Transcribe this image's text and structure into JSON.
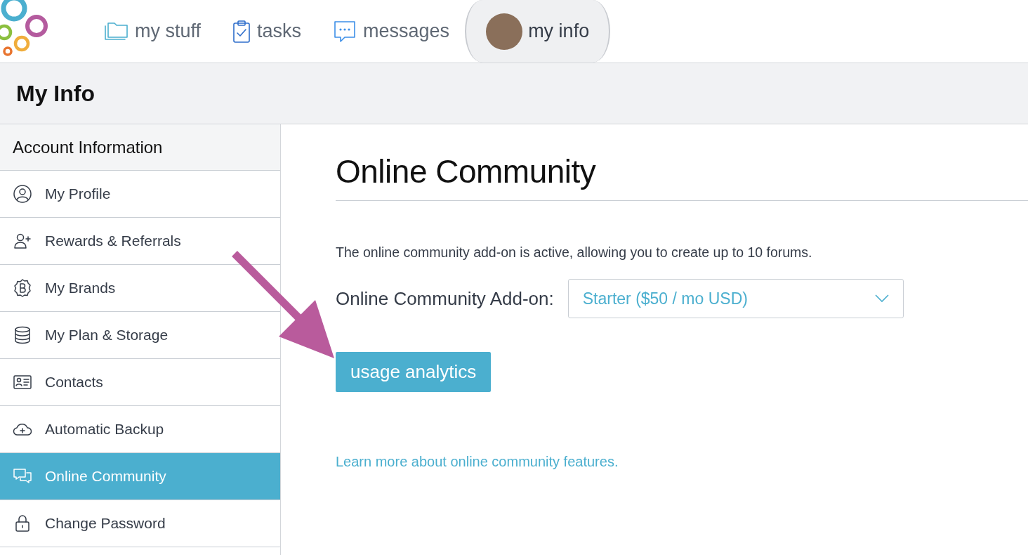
{
  "nav": {
    "tabs": [
      {
        "label": "my stuff",
        "selected": false
      },
      {
        "label": "tasks",
        "selected": false
      },
      {
        "label": "messages",
        "selected": false
      },
      {
        "label": "my info",
        "selected": true
      }
    ]
  },
  "page_title": "My Info",
  "sidebar": {
    "heading": "Account Information",
    "items": [
      {
        "label": "My Profile",
        "selected": false
      },
      {
        "label": "Rewards & Referrals",
        "selected": false
      },
      {
        "label": "My Brands",
        "selected": false
      },
      {
        "label": "My Plan & Storage",
        "selected": false
      },
      {
        "label": "Contacts",
        "selected": false
      },
      {
        "label": "Automatic Backup",
        "selected": false
      },
      {
        "label": "Online Community",
        "selected": true
      },
      {
        "label": "Change Password",
        "selected": false
      }
    ]
  },
  "content": {
    "title": "Online Community",
    "description": "The online community add-on is active, allowing you to create up to 10 forums.",
    "addon": {
      "label": "Online Community Add-on:",
      "value": "Starter ($50 / mo USD)"
    },
    "button": "usage analytics",
    "link": "Learn more about online community features."
  }
}
